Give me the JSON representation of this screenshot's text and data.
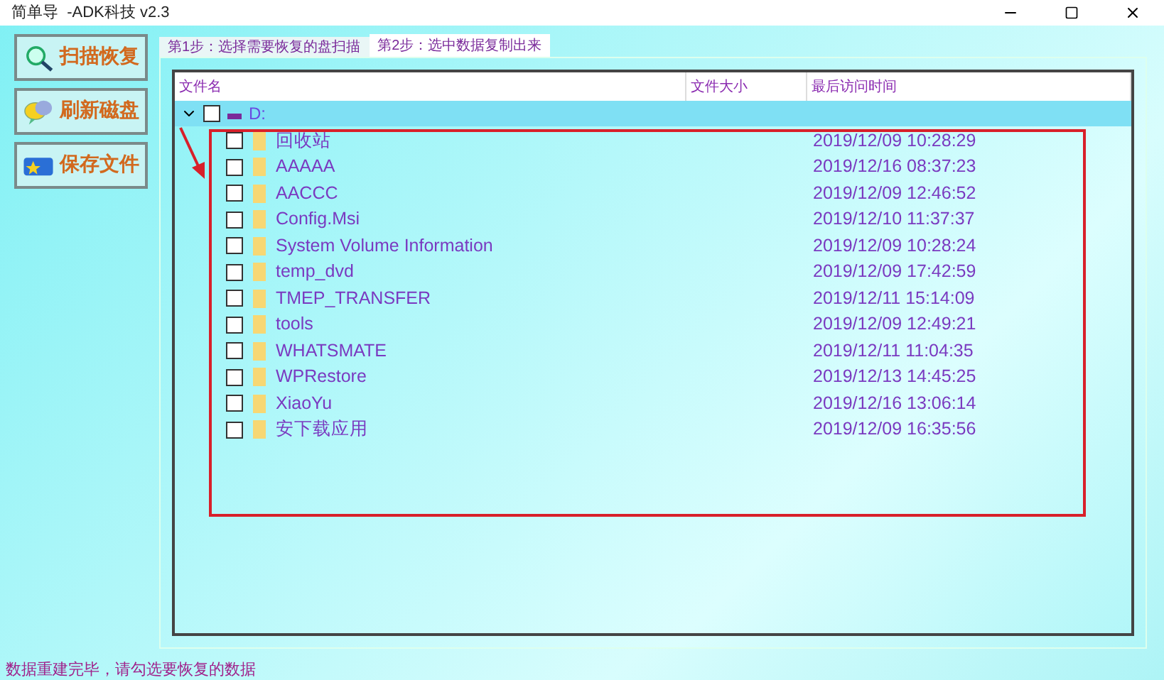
{
  "window": {
    "title": "简单导  -ADK科技 v2.3"
  },
  "sidebar": {
    "buttons": [
      "扫描恢复",
      "刷新磁盘",
      "保存文件"
    ]
  },
  "tabs": [
    {
      "label": "第1步：选择需要恢复的盘扫描",
      "selected": false
    },
    {
      "label": "第2步：选中数据复制出来",
      "selected": true
    }
  ],
  "table": {
    "columns": [
      "文件名",
      "文件大小",
      "最后访问时间"
    ],
    "tree": {
      "name": "D:",
      "expanded": true,
      "checked": false,
      "selected": true,
      "children": [
        {
          "name": "回收站",
          "checked": false,
          "time": "2019/12/09 10:28:29"
        },
        {
          "name": "AAAAA",
          "checked": false,
          "time": "2019/12/16 08:37:23"
        },
        {
          "name": "AACCC",
          "checked": false,
          "time": "2019/12/09 12:46:52"
        },
        {
          "name": "Config.Msi",
          "checked": false,
          "time": "2019/12/10 11:37:37"
        },
        {
          "name": "System Volume Information",
          "checked": false,
          "time": "2019/12/09 10:28:24"
        },
        {
          "name": "temp_dvd",
          "checked": false,
          "time": "2019/12/09 17:42:59"
        },
        {
          "name": "TMEP_TRANSFER",
          "checked": false,
          "time": "2019/12/11 15:14:09"
        },
        {
          "name": "tools",
          "checked": false,
          "time": "2019/12/09 12:49:21"
        },
        {
          "name": "WHATSMATE",
          "checked": false,
          "time": "2019/12/11 11:04:35"
        },
        {
          "name": "WPRestore",
          "checked": false,
          "time": "2019/12/13 14:45:25"
        },
        {
          "name": "XiaoYu",
          "checked": false,
          "time": "2019/12/16 13:06:14"
        },
        {
          "name": "安下载应用",
          "checked": false,
          "time": "2019/12/09 16:35:56"
        }
      ]
    }
  },
  "status_bar": {
    "text": "数据重建完毕，请勾选要恢复的数据"
  }
}
